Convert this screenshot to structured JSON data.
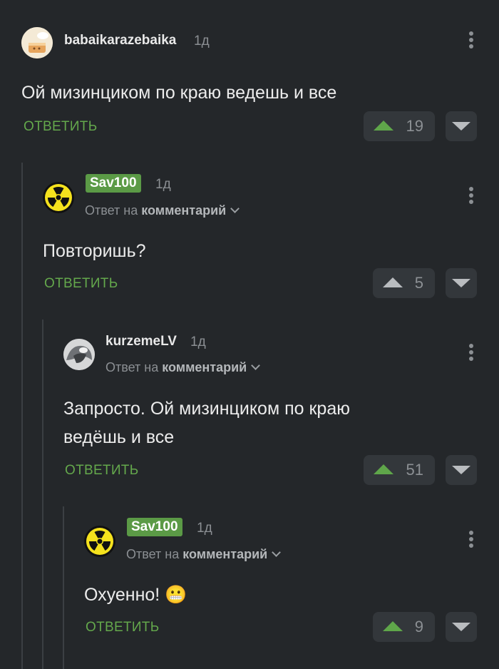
{
  "colors": {
    "background": "#24272a",
    "accent_green": "#64a84c",
    "badge_green": "#5b9a46",
    "muted": "#8b8f93"
  },
  "comments": [
    {
      "username": "babaikarazebaika",
      "time": "1д",
      "reply_prefix": "",
      "reply_target": "",
      "text_lines": [
        "Ой мизинциком по краю ведешь и все"
      ],
      "reply_label": "ОТВЕТИТЬ",
      "votes": "19",
      "up_color": "#5fa64a",
      "avatar_icon": "chef-cake-avatar"
    },
    {
      "username": "Sav100",
      "time": "1д",
      "reply_prefix": "Ответ на",
      "reply_target": "комментарий",
      "text_lines": [
        "Повторишь?"
      ],
      "reply_label": "ОТВЕТИТЬ",
      "votes": "5",
      "up_color": "#b9bcbf",
      "avatar_icon": "radiation-icon"
    },
    {
      "username": "kurzemeLV",
      "time": "1д",
      "reply_prefix": "Ответ на",
      "reply_target": "комментарий",
      "text_lines": [
        "Запросто. Ой мизинциком по краю",
        "ведёшь и все"
      ],
      "reply_label": "ОТВЕТИТЬ",
      "votes": "51",
      "up_color": "#5fa64a",
      "avatar_icon": "photo-avatar"
    },
    {
      "username": "Sav100",
      "time": "1д",
      "reply_prefix": "Ответ на",
      "reply_target": "комментарий",
      "text_lines": [
        "Охуенно!"
      ],
      "emoji": "😬",
      "reply_label": "ОТВЕТИТЬ",
      "votes": "9",
      "up_color": "#5fa64a",
      "avatar_icon": "radiation-icon"
    }
  ]
}
